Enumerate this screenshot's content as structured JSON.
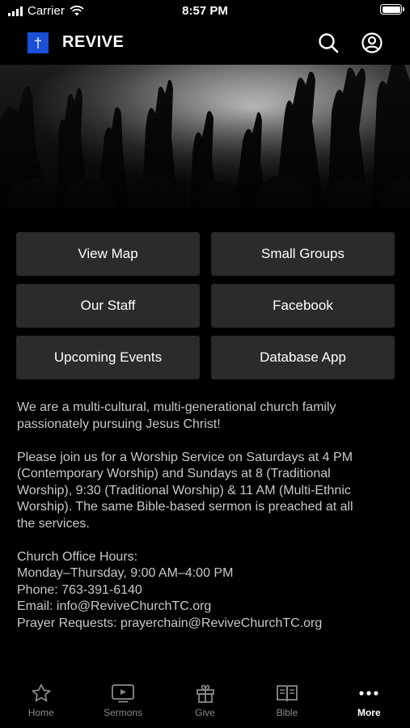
{
  "status_bar": {
    "carrier": "Carrier",
    "time": "8:57 PM"
  },
  "header": {
    "title": "REVIVE"
  },
  "buttons": [
    {
      "label": "View Map"
    },
    {
      "label": "Small Groups"
    },
    {
      "label": "Our Staff"
    },
    {
      "label": "Facebook"
    },
    {
      "label": "Upcoming Events"
    },
    {
      "label": "Database App"
    }
  ],
  "info": {
    "intro": [
      "We are a multi-cultural, multi-generational church family",
      "passionately pursuing Jesus Christ!"
    ],
    "worship": [
      "Please join us for a Worship Service on Saturdays at 4 PM",
      "(Contemporary Worship) and Sundays at 8 (Traditional",
      "Worship), 9:30 (Traditional Worship) & 11 AM (Multi-Ethnic",
      "Worship). The same Bible-based sermon is preached at all",
      "the services."
    ],
    "office_hours_label": "Church Office Hours:",
    "office_hours": "Monday–Thursday, 9:00 AM–4:00 PM",
    "phone": "Phone: 763-391-6140",
    "email": "Email: info@ReviveChurchTC.org",
    "prayer": "Prayer Requests: prayerchain@ReviveChurchTC.org"
  },
  "tabs": [
    {
      "label": "Home",
      "icon": "star-icon"
    },
    {
      "label": "Sermons",
      "icon": "tv-icon"
    },
    {
      "label": "Give",
      "icon": "gift-icon"
    },
    {
      "label": "Bible",
      "icon": "book-icon"
    },
    {
      "label": "More",
      "icon": "more-icon",
      "active": true
    }
  ],
  "colors": {
    "background": "#000000",
    "tile": "#2b2b2b",
    "logo": "#1a4fd6",
    "tab_inactive": "#8a8a8a"
  }
}
